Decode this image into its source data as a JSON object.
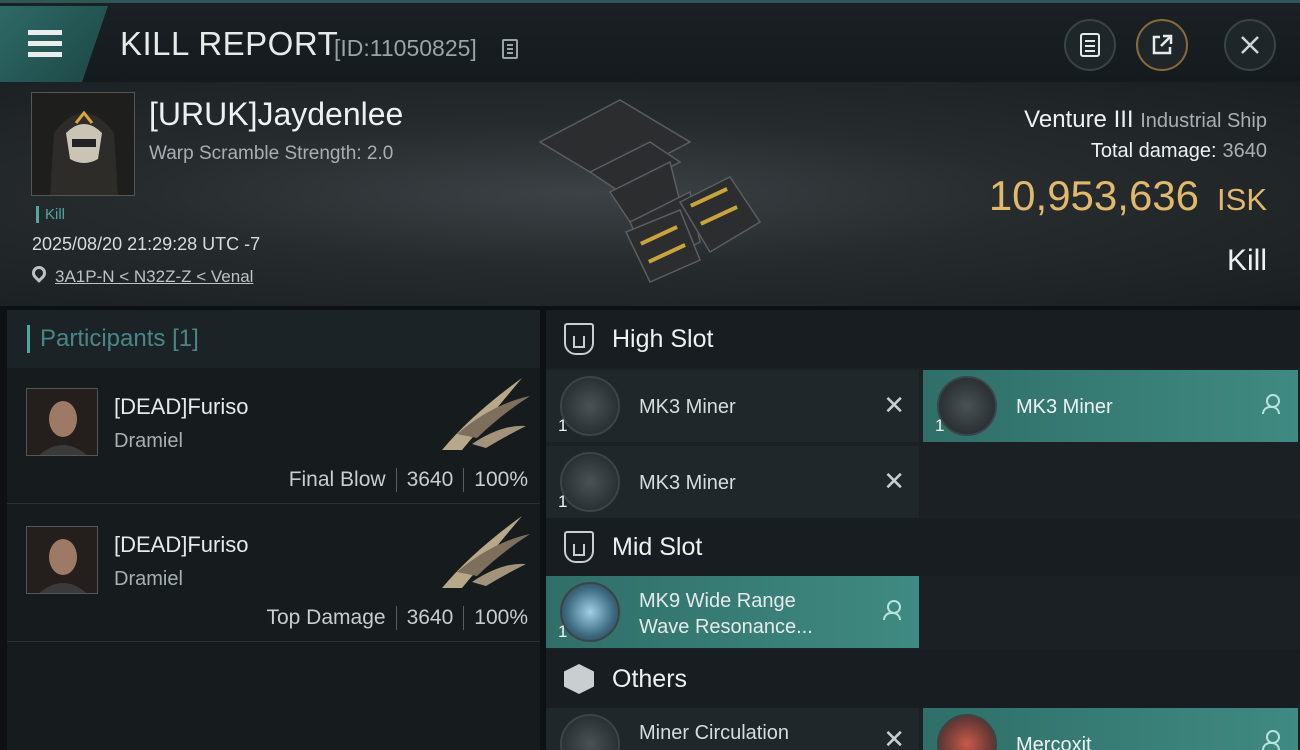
{
  "header": {
    "title": "KILL REPORT",
    "id_text": "[ID:11050825]",
    "icons": [
      "menu-icon",
      "copy-icon",
      "clipboard-icon",
      "share-icon",
      "close-icon"
    ],
    "accent_color": "#2d6a66"
  },
  "victim": {
    "name": "[URUK]Jaydenlee",
    "warp_scramble": "Warp Scramble Strength: 2.0",
    "tag": "Kill",
    "datetime": "2025/08/20 21:29:28 UTC -7",
    "location": "3A1P-N < N32Z-Z < Venal",
    "ship_name": "Venture III",
    "ship_class": "Industrial Ship",
    "total_damage_label": "Total damage:",
    "total_damage": "3640",
    "isk_value": "10,953,636",
    "isk_unit": "ISK",
    "result": "Kill",
    "isk_color": "#e2b86b"
  },
  "participants": {
    "title": "Participants",
    "count": "[1]",
    "rows": [
      {
        "name": "[DEAD]Furiso",
        "ship": "Dramiel",
        "role": "Final Blow",
        "damage": "3640",
        "percent": "100%"
      },
      {
        "name": "[DEAD]Furiso",
        "ship": "Dramiel",
        "role": "Top Damage",
        "damage": "3640",
        "percent": "100%"
      }
    ]
  },
  "fitting": {
    "high_slot": {
      "label": "High Slot",
      "destroyed": [
        {
          "name": "MK3 Miner",
          "qty": "1"
        },
        {
          "name": "MK3 Miner",
          "qty": "1"
        }
      ],
      "dropped": [
        {
          "name": "MK3 Miner",
          "qty": "1"
        }
      ]
    },
    "mid_slot": {
      "label": "Mid Slot",
      "dropped": [
        {
          "name_line1": "MK9 Wide Range",
          "name_line2": "Wave Resonance...",
          "qty": "1"
        }
      ]
    },
    "others": {
      "label": "Others",
      "destroyed": [
        {
          "name": "Miner Circulation"
        }
      ],
      "dropped": [
        {
          "name": "Mercoxit"
        }
      ]
    }
  }
}
